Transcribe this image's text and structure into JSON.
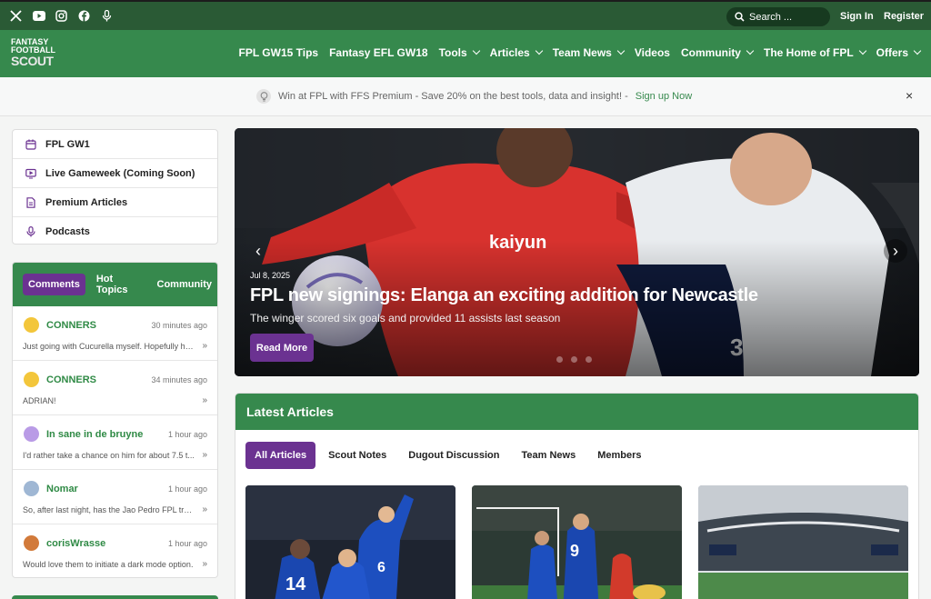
{
  "topbar": {
    "search_placeholder": "Search ...",
    "sign_in": "Sign In",
    "register": "Register"
  },
  "logo": {
    "line1": "FANTASY",
    "line2": "FOOTBALL",
    "line3": "SCOUT"
  },
  "nav": [
    {
      "label": "FPL GW15 Tips",
      "dropdown": false
    },
    {
      "label": "Fantasy EFL GW18",
      "dropdown": false
    },
    {
      "label": "Tools",
      "dropdown": true
    },
    {
      "label": "Articles",
      "dropdown": true
    },
    {
      "label": "Team News",
      "dropdown": true
    },
    {
      "label": "Videos",
      "dropdown": false
    },
    {
      "label": "Community",
      "dropdown": true
    },
    {
      "label": "The Home of FPL",
      "dropdown": true
    },
    {
      "label": "Offers",
      "dropdown": true
    }
  ],
  "promo": {
    "text": "Win at FPL with FFS Premium - Save 20% on the best tools, data and insight! -",
    "link": "Sign up Now",
    "close": "×"
  },
  "quick_links": [
    {
      "label": "FPL GW1",
      "icon": "calendar-icon"
    },
    {
      "label": "Live Gameweek (Coming Soon)",
      "icon": "tv-icon"
    },
    {
      "label": "Premium Articles",
      "icon": "document-icon"
    },
    {
      "label": "Podcasts",
      "icon": "microphone-icon"
    }
  ],
  "comments": {
    "tabs": [
      "Comments",
      "Hot Topics",
      "Community"
    ],
    "items": [
      {
        "name": "CONNERS",
        "time": "30 minutes ago",
        "text": "Just going with Cucurella myself. Hopefully he's...",
        "avatar": "#f3c63b"
      },
      {
        "name": "CONNERS",
        "time": "34 minutes ago",
        "text": "ADRIAN!",
        "avatar": "#f3c63b"
      },
      {
        "name": "In sane in de bruyne",
        "time": "1 hour ago",
        "text": "I'd rather take a chance on him for about 7.5 t...",
        "avatar": "#b99be6"
      },
      {
        "name": "Nomar",
        "time": "1 hour ago",
        "text": "So, after last night, has the Jao Pedro FPL trap ...",
        "avatar": "#9fb7d4"
      },
      {
        "name": "corisWrasse",
        "time": "1 hour ago",
        "text": "Would love them to initiate a dark mode option.",
        "avatar": "#d27a3a"
      }
    ],
    "more": "»"
  },
  "hero": {
    "date": "Jul 8, 2025",
    "title": "FPL new signings: Elanga an exciting addition for Newcastle",
    "subtitle": "The winger scored six goals and provided 11 assists last season",
    "button": "Read More",
    "prev": "‹",
    "next": "›",
    "shirt_sponsor": "kaiyun",
    "shirt_number": "3"
  },
  "latest": {
    "title": "Latest Articles",
    "tabs": [
      "All Articles",
      "Scout Notes",
      "Dugout Discussion",
      "Team News",
      "Members"
    ],
    "thumb_numbers": [
      "14",
      "6",
      "9"
    ]
  }
}
